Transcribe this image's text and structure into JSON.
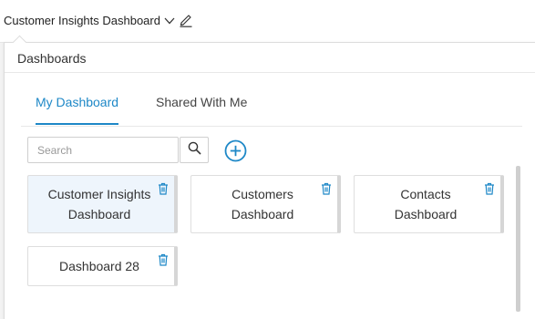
{
  "header": {
    "title": "Customer Insights Dashboard",
    "dropdown_icon": "chevron-down-icon",
    "edit_icon": "pencil-icon"
  },
  "panel": {
    "title": "Dashboards",
    "tabs": [
      {
        "label": "My Dashboard",
        "active": true
      },
      {
        "label": "Shared With Me",
        "active": false
      }
    ],
    "search": {
      "placeholder": "Search",
      "value": ""
    },
    "add_icon": "plus-circle-icon",
    "dashboards": [
      {
        "name": "Customer Insights\nDashboard",
        "selected": true
      },
      {
        "name": "Customers\nDashboard",
        "selected": false
      },
      {
        "name": "Contacts\nDashboard",
        "selected": false
      },
      {
        "name": "Dashboard 28",
        "selected": false
      }
    ]
  },
  "colors": {
    "accent": "#1e88c7",
    "selected_card_bg": "#eef5fc"
  }
}
